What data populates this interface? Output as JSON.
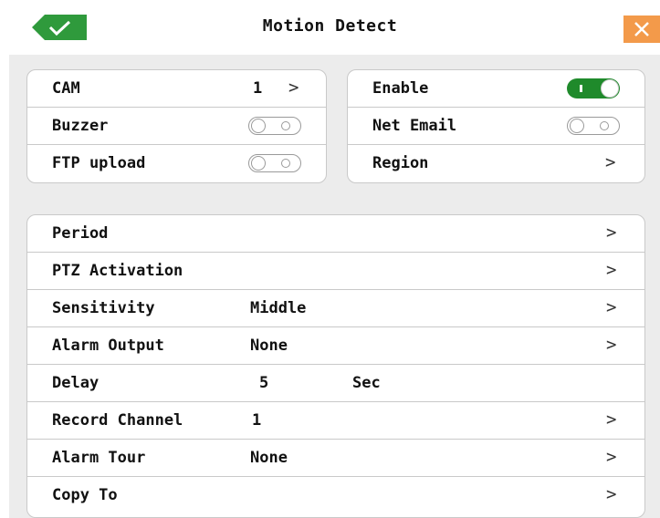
{
  "window": {
    "title": "Motion Detect"
  },
  "top_left": {
    "cam": {
      "label": "CAM",
      "value": "1"
    },
    "buzzer": {
      "label": "Buzzer"
    },
    "ftp": {
      "label": "FTP upload"
    }
  },
  "top_right": {
    "enable": {
      "label": "Enable"
    },
    "net_email": {
      "label": "Net Email"
    },
    "region": {
      "label": "Region"
    }
  },
  "settings": {
    "period": {
      "label": "Period"
    },
    "ptz": {
      "label": "PTZ Activation"
    },
    "sensitivity": {
      "label": "Sensitivity",
      "value": "Middle"
    },
    "alarm_output": {
      "label": "Alarm Output",
      "value": "None"
    },
    "delay": {
      "label": "Delay",
      "value": "5",
      "unit": "Sec"
    },
    "record_channel": {
      "label": "Record Channel",
      "value": "1"
    },
    "alarm_tour": {
      "label": "Alarm Tour",
      "value": "None"
    },
    "copy_to": {
      "label": "Copy To"
    }
  },
  "toggles": {
    "enable": true,
    "buzzer": false,
    "net_email": false,
    "ftp_upload": false
  },
  "icons": {
    "ok": "checkmark-icon",
    "close": "close-icon",
    "arrow": "chevron-right-icon"
  },
  "colors": {
    "accept_green": "#2f9a3c",
    "close_orange": "#f39a4a",
    "toggle_on": "#1f8a2b",
    "panel": "#ececec"
  }
}
